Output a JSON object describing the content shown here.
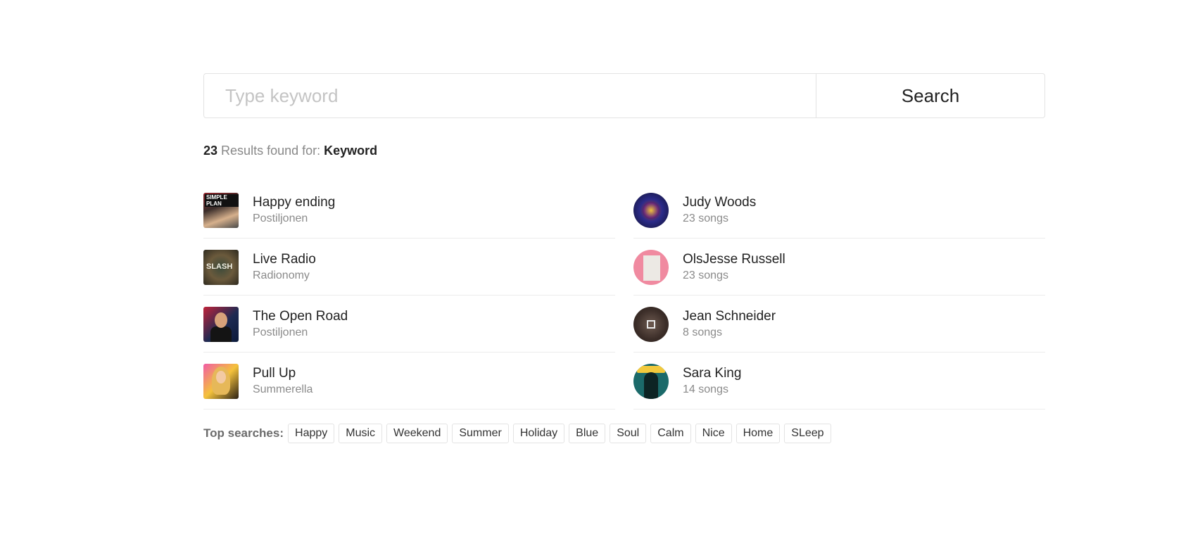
{
  "search": {
    "placeholder": "Type keyword",
    "value": "",
    "button_label": "Search"
  },
  "summary": {
    "count": "23",
    "text": "Results found for:",
    "keyword": "Keyword"
  },
  "tracks": [
    {
      "title": "Happy ending",
      "subtitle": "Postiljonen",
      "icon": "album-art"
    },
    {
      "title": "Live Radio",
      "subtitle": "Radionomy",
      "icon": "album-art"
    },
    {
      "title": "The Open Road",
      "subtitle": "Postiljonen",
      "icon": "album-art"
    },
    {
      "title": "Pull Up",
      "subtitle": "Summerella",
      "icon": "album-art"
    }
  ],
  "artists": [
    {
      "name": "Judy Woods",
      "songs": "23 songs",
      "icon": "artist-avatar"
    },
    {
      "name": "OlsJesse Russell",
      "songs": "23 songs",
      "icon": "artist-avatar"
    },
    {
      "name": "Jean Schneider",
      "songs": "8 songs",
      "icon": "artist-avatar"
    },
    {
      "name": "Sara King",
      "songs": "14 songs",
      "icon": "artist-avatar"
    }
  ],
  "top_searches": {
    "label": "Top searches:",
    "tags": [
      "Happy",
      "Music",
      "Weekend",
      "Summer",
      "Holiday",
      "Blue",
      "Soul",
      "Calm",
      "Nice",
      "Home",
      "SLeep"
    ]
  },
  "album_art_text": {
    "art1": "SIMPLE PLAN",
    "art2": "SLASH"
  }
}
